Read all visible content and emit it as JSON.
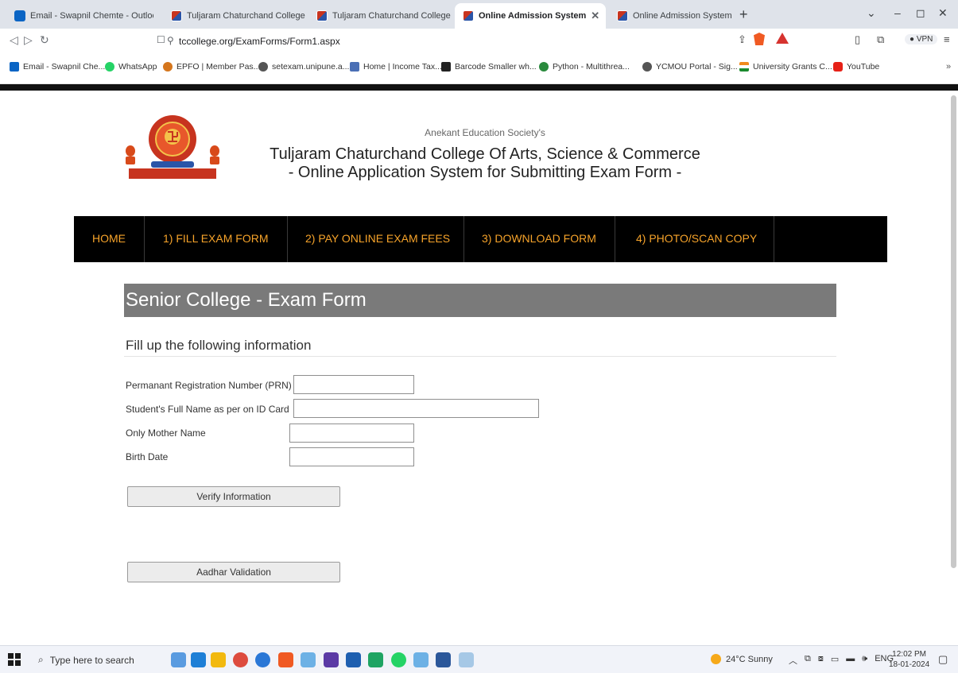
{
  "browser": {
    "tabs": [
      {
        "label": "Email - Swapnil Chemte - Outlook",
        "icon": "outlook-icon",
        "active": false
      },
      {
        "label": "Tuljaram Chaturchand College | Arts, S",
        "icon": "college-icon",
        "active": false
      },
      {
        "label": "Tuljaram Chaturchand College | Arts, S",
        "icon": "college-icon",
        "active": false
      },
      {
        "label": "Online Admission System",
        "icon": "college-icon",
        "active": true
      },
      {
        "label": "Online Admission System",
        "icon": "college-icon",
        "active": false
      }
    ],
    "url": "tccollege.org/ExamForms/Form1.aspx",
    "vpn_label": "VPN",
    "bookmarks": [
      {
        "label": "Email - Swapnil Che...",
        "color": "#0a64c4"
      },
      {
        "label": "WhatsApp",
        "color": "#25d366"
      },
      {
        "label": "EPFO | Member Pas...",
        "color": "#d5761d"
      },
      {
        "label": "setexam.unipune.a...",
        "color": "#555555"
      },
      {
        "label": "Home | Income Tax...",
        "color": "#4a6fb5"
      },
      {
        "label": "Barcode Smaller wh...",
        "color": "#222222"
      },
      {
        "label": "Python - Multithrea...",
        "color": "#2a8a3d"
      },
      {
        "label": "YCMOU Portal - Sig...",
        "color": "#555555"
      },
      {
        "label": "University Grants C...",
        "color": "#f08a1c"
      },
      {
        "label": "YouTube",
        "color": "#e62117"
      }
    ],
    "bookmarks_more": "»"
  },
  "page": {
    "org": "Anekant Education Society's",
    "college": "Tuljaram Chaturchand College Of Arts, Science & Commerce",
    "subtitle": "- Online Application System for Submitting Exam Form -",
    "menu": [
      "HOME",
      "1) FILL EXAM FORM",
      "2) PAY ONLINE EXAM FEES",
      "3) DOWNLOAD FORM",
      "4) PHOTO/SCAN COPY"
    ],
    "form_title": "Senior College - Exam Form",
    "fill_heading": "Fill up the following information",
    "fields": [
      {
        "label": "Permanant Registration Number (PRN)",
        "value": ""
      },
      {
        "label": "Student's Full Name as per on ID Card",
        "value": ""
      },
      {
        "label": "Only Mother Name",
        "value": ""
      },
      {
        "label": "Birth Date",
        "value": ""
      }
    ],
    "verify_button": "Verify Information",
    "aadhar_button": "Aadhar Validation",
    "colors": {
      "menu_bg": "#000000",
      "menu_text": "#f6a32a",
      "title_bar": "#7a7a7a"
    }
  },
  "taskbar": {
    "search_placeholder": "Type here to search",
    "weather": "24°C  Sunny",
    "lang": "ENG",
    "time": "12:02 PM",
    "date": "18-01-2024"
  }
}
